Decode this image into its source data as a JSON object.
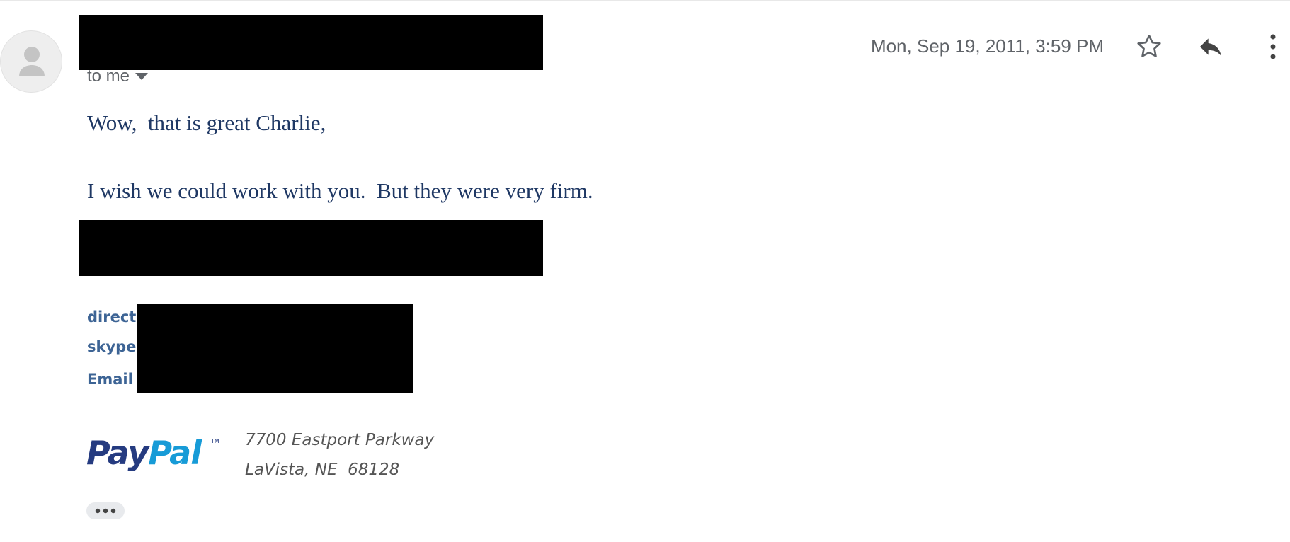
{
  "message": {
    "recipient_label": "to me",
    "date": "Mon, Sep 19, 2011, 3:59 PM",
    "body_lines": [
      "Wow,  that is great Charlie,",
      "I wish we could work with you.  But they were very firm."
    ]
  },
  "signature": {
    "labels": {
      "direct": "direct",
      "skype": "skype",
      "email": "Email"
    },
    "logo_text": "PayPal",
    "logo_mark": "TM",
    "address_lines": [
      "7700 Eastport Parkway",
      "LaVista, NE  68128"
    ]
  },
  "icons": {
    "avatar": "default-person-avatar",
    "recipients_toggle": "caret-down-icon",
    "star": "star-outline-icon",
    "reply": "reply-icon",
    "more": "more-vert-icon",
    "trimmed_content": "more-horiz-icon"
  },
  "colors": {
    "body_text": "#1f3864",
    "signature_label": "#3d6495",
    "meta_text": "#5f6368",
    "redaction": "#000000",
    "logo_dark_blue": "#253b80",
    "logo_light_blue": "#179bd7"
  }
}
